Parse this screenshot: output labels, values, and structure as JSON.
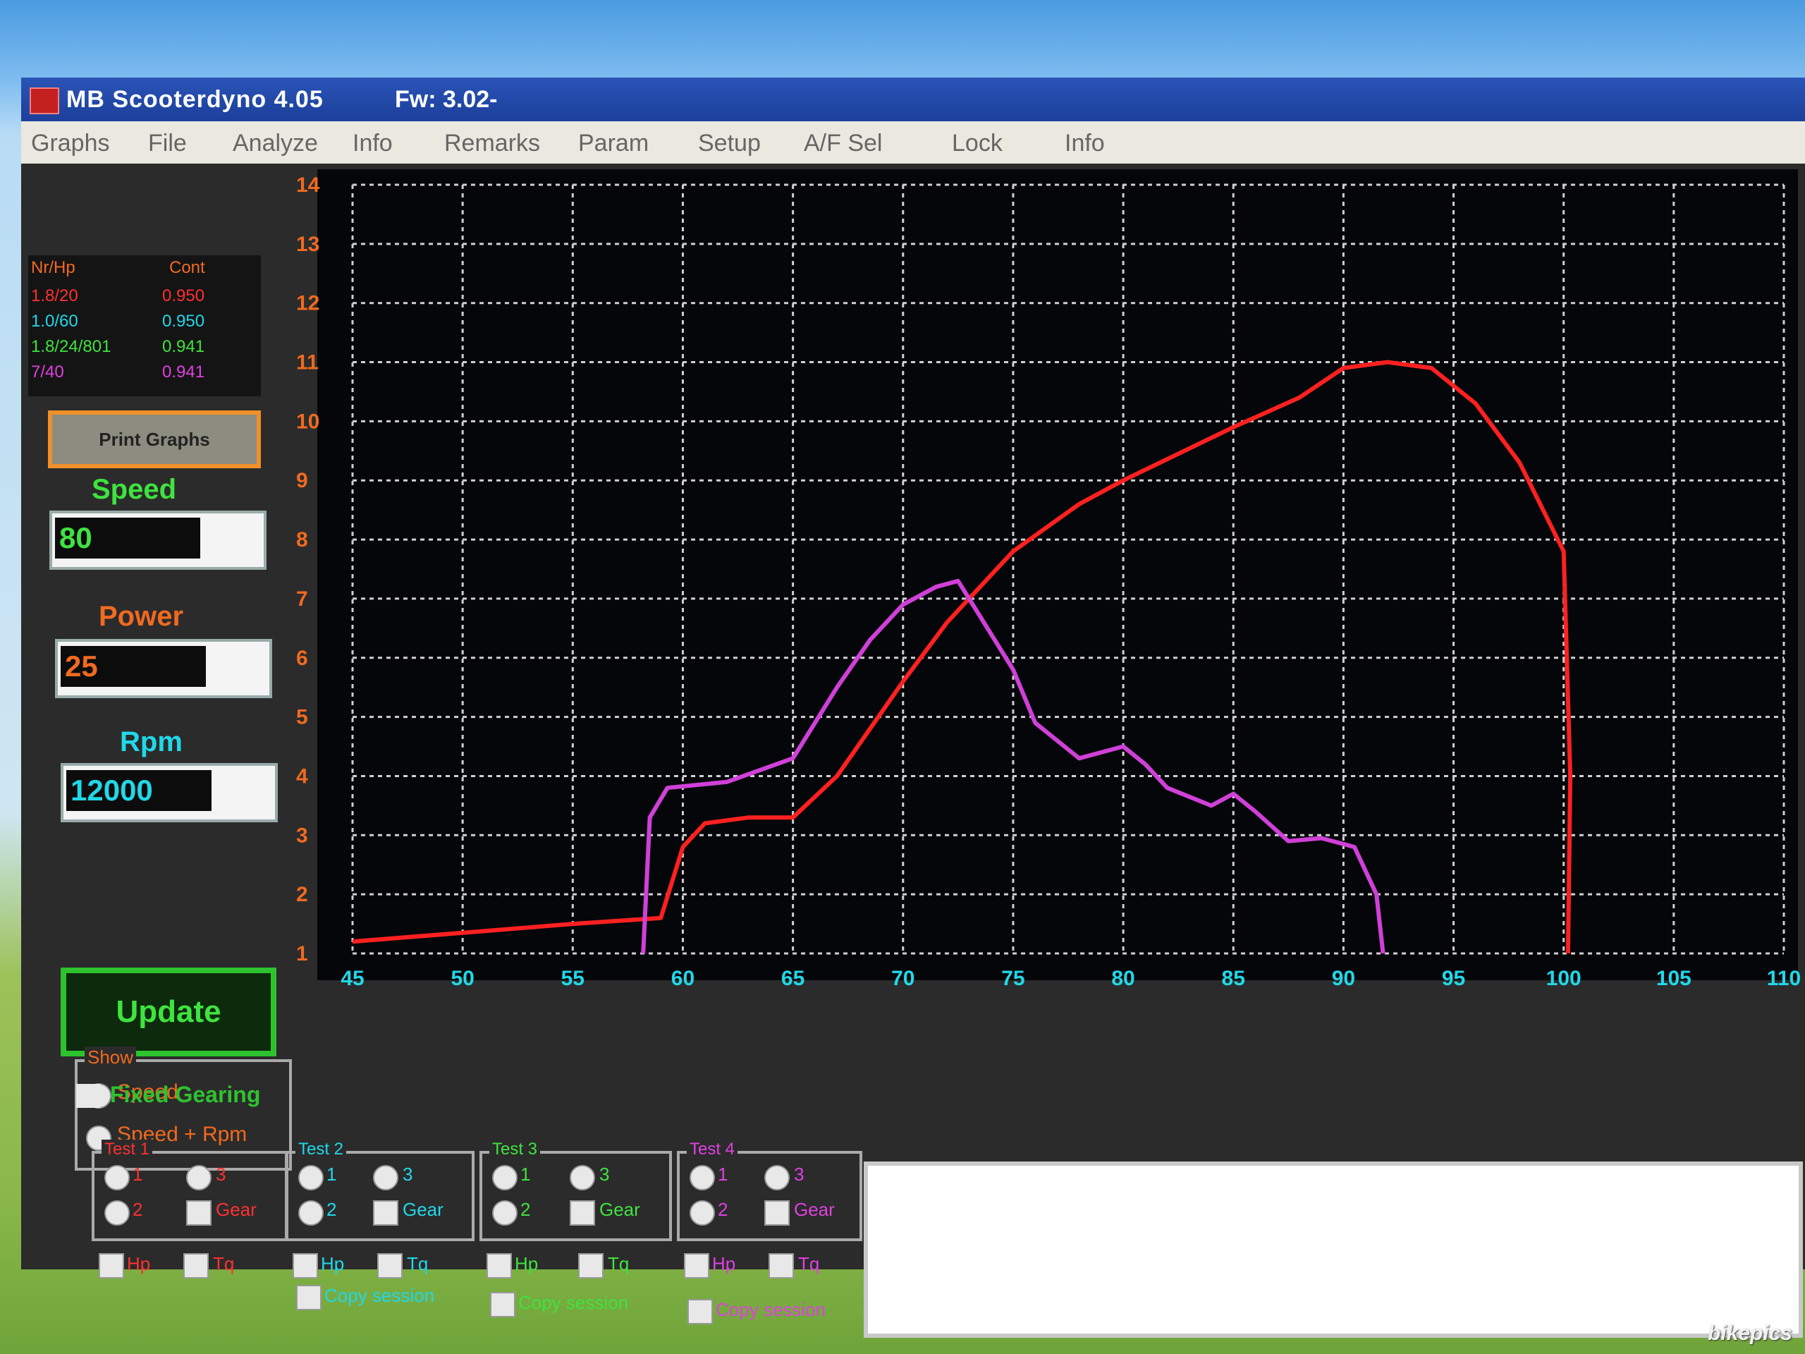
{
  "window": {
    "title": "MB Scooterdyno 4.05",
    "firmware": "Fw: 3.02-"
  },
  "menu": [
    "Graphs",
    "File",
    "Analyze",
    "Info",
    "Remarks",
    "Param",
    "Setup",
    "A/F Sel",
    "Lock",
    "Info"
  ],
  "legend": {
    "col1_header": "Nr/Hp",
    "col2_header": "Cont",
    "rows": [
      {
        "name": "1.8/20",
        "value": "0.950",
        "color": "#ff3030"
      },
      {
        "name": "1.0/60",
        "value": "0.950",
        "color": "#20d8e8"
      },
      {
        "name": "1.8/24/801",
        "value": "0.941",
        "color": "#3fe33f"
      },
      {
        "name": "7/40",
        "value": "0.941",
        "color": "#e040e0"
      }
    ]
  },
  "print_button": "Print Graphs",
  "fields": {
    "speed": {
      "label": "Speed",
      "value": "80"
    },
    "power": {
      "label": "Power",
      "value": "25"
    },
    "rpm": {
      "label": "Rpm",
      "value": "12000"
    }
  },
  "update_button": "Update",
  "show": {
    "title": "Show",
    "options": [
      "Speed",
      "Speed + Rpm"
    ],
    "selected": "Speed + Rpm"
  },
  "fixed_gearing": "Fixed Gearing",
  "tests": [
    {
      "title": "Test 1",
      "opt1": "1",
      "opt2": "2",
      "opt3": "3",
      "gear": "Gear",
      "hp": "Hp",
      "tq": "Tq",
      "copy": "",
      "color": "#ff3030"
    },
    {
      "title": "Test 2",
      "opt1": "1",
      "opt2": "2",
      "opt3": "3",
      "gear": "Gear",
      "hp": "Hp",
      "tq": "Tq",
      "copy": "Copy session",
      "color": "#20d8e8"
    },
    {
      "title": "Test 3",
      "opt1": "1",
      "opt2": "2",
      "opt3": "3",
      "gear": "Gear",
      "hp": "Hp",
      "tq": "Tq",
      "copy": "Copy session",
      "color": "#3fe33f"
    },
    {
      "title": "Test 4",
      "opt1": "1",
      "opt2": "2",
      "opt3": "3",
      "gear": "Gear",
      "hp": "Hp",
      "tq": "Tq",
      "copy": "Copy session",
      "color": "#e040e0"
    }
  ],
  "watermark": "bikepics",
  "chart_data": {
    "type": "line",
    "xlim": [
      45,
      110
    ],
    "ylim": [
      1,
      14
    ],
    "x_ticks": [
      45,
      50,
      55,
      60,
      65,
      70,
      75,
      80,
      85,
      90,
      95,
      100,
      105,
      110
    ],
    "y_ticks": [
      1,
      2,
      3,
      4,
      5,
      6,
      7,
      8,
      9,
      10,
      11,
      12,
      13,
      14
    ],
    "grid": true,
    "x_tick_color": "#20d8e8",
    "y_tick_color": "#f06a20",
    "series": [
      {
        "color": "#ff2020",
        "points": [
          [
            45,
            1.2
          ],
          [
            50,
            1.35
          ],
          [
            55,
            1.5
          ],
          [
            59,
            1.6
          ],
          [
            60,
            2.8
          ],
          [
            61,
            3.2
          ],
          [
            63,
            3.3
          ],
          [
            65,
            3.3
          ],
          [
            67,
            4.0
          ],
          [
            70,
            5.6
          ],
          [
            72,
            6.6
          ],
          [
            75,
            7.8
          ],
          [
            78,
            8.6
          ],
          [
            80,
            9.0
          ],
          [
            85,
            9.9
          ],
          [
            88,
            10.4
          ],
          [
            90,
            10.9
          ],
          [
            92,
            11.0
          ],
          [
            94,
            10.9
          ],
          [
            96,
            10.3
          ],
          [
            98,
            9.3
          ],
          [
            100,
            7.8
          ],
          [
            100.3,
            4
          ],
          [
            100.2,
            1
          ]
        ]
      },
      {
        "color": "#d040d8",
        "points": [
          [
            58.2,
            1
          ],
          [
            58.5,
            3.3
          ],
          [
            59.3,
            3.8
          ],
          [
            62,
            3.9
          ],
          [
            65,
            4.3
          ],
          [
            67,
            5.5
          ],
          [
            68.5,
            6.3
          ],
          [
            70,
            6.9
          ],
          [
            71.5,
            7.2
          ],
          [
            72.5,
            7.3
          ],
          [
            73.5,
            6.7
          ],
          [
            75,
            5.8
          ],
          [
            76,
            4.9
          ],
          [
            77,
            4.6
          ],
          [
            78,
            4.3
          ],
          [
            79,
            4.4
          ],
          [
            80,
            4.5
          ],
          [
            81,
            4.2
          ],
          [
            82,
            3.8
          ],
          [
            84,
            3.5
          ],
          [
            85,
            3.7
          ],
          [
            86,
            3.4
          ],
          [
            87.5,
            2.9
          ],
          [
            89,
            2.95
          ],
          [
            90.5,
            2.8
          ],
          [
            91.5,
            2.0
          ],
          [
            91.8,
            1
          ]
        ]
      }
    ]
  }
}
